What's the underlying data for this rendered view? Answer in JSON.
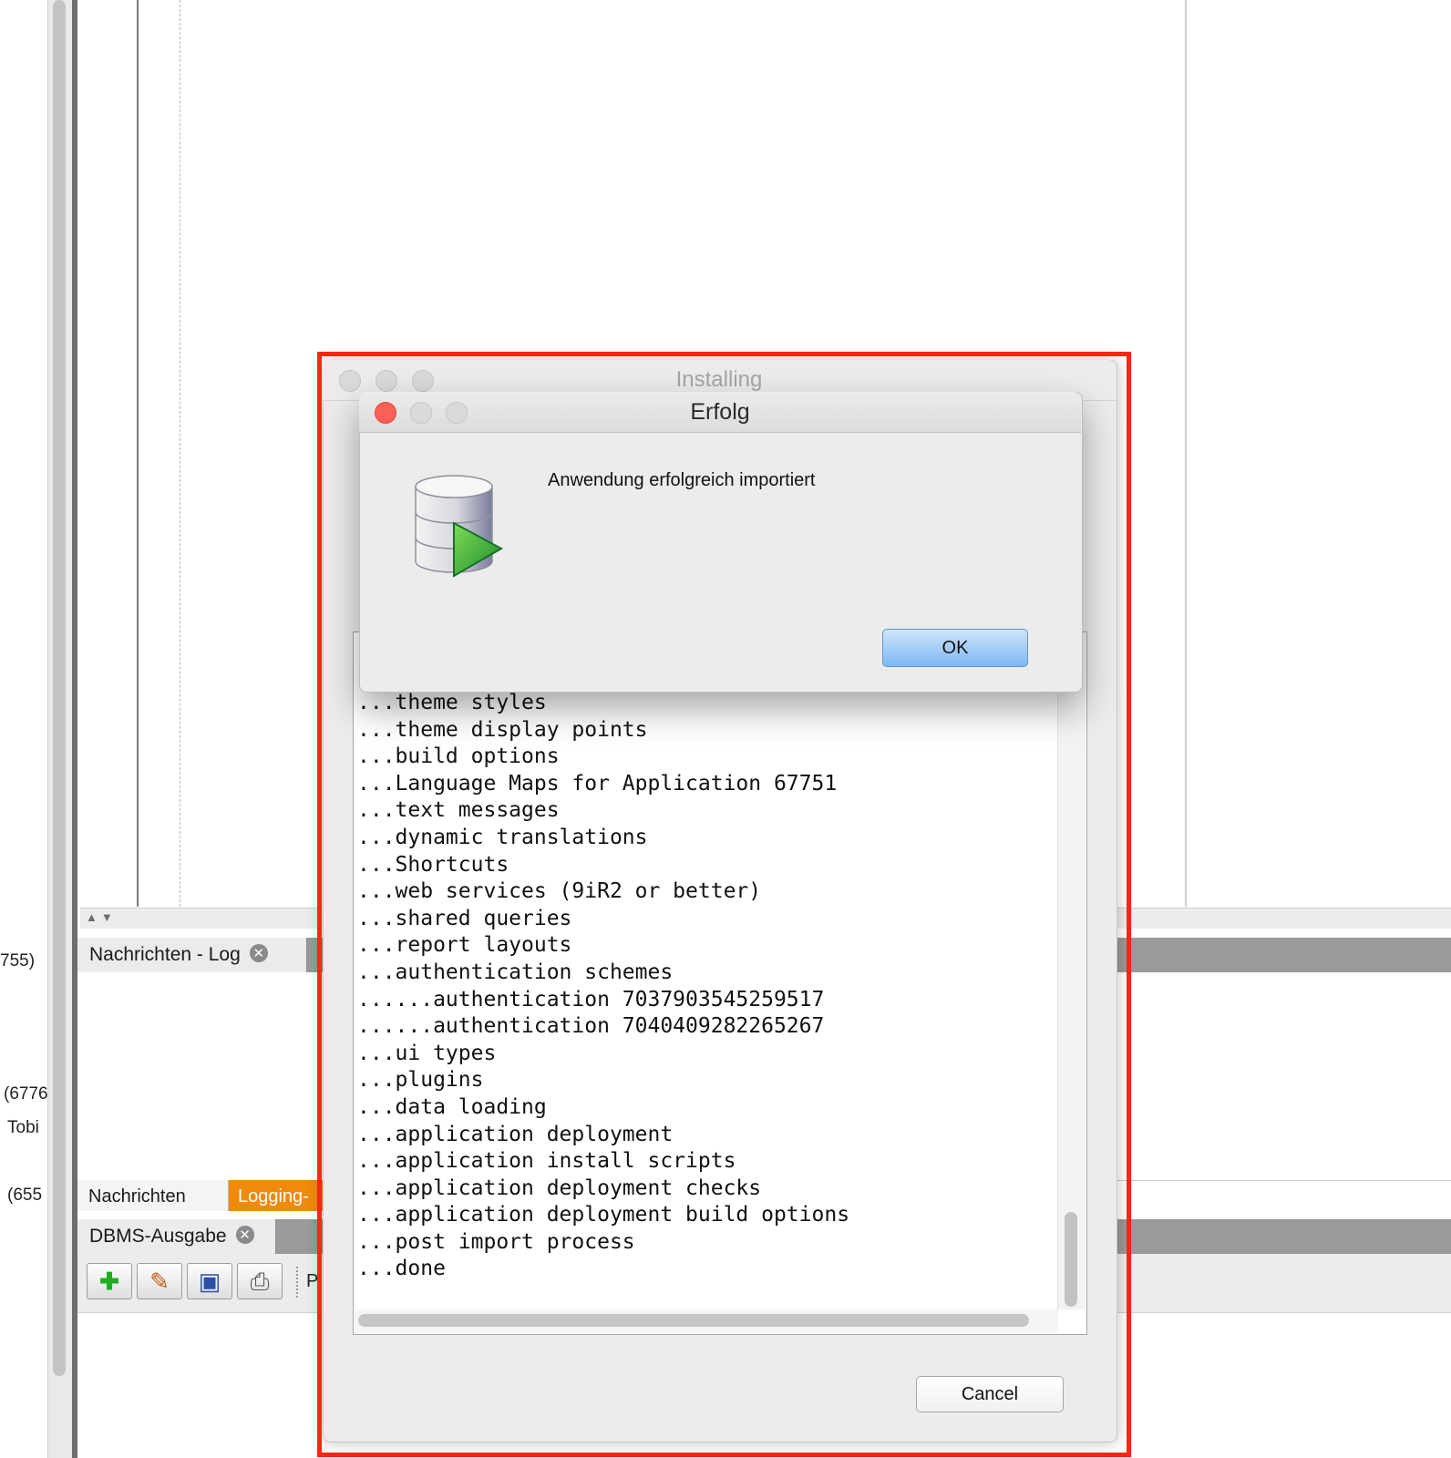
{
  "left_panel": {
    "snippets": [
      "755)",
      "(6776",
      "Tobi",
      "(655"
    ]
  },
  "bottom": {
    "log_tab_label": "Nachrichten - Log",
    "bottom_tabs": {
      "messages": "Nachrichten",
      "logging": "Logging-"
    },
    "dbms_tab_label": "DBMS-Ausgabe",
    "toolbar_trailing_text": "P",
    "colors": {
      "logging_tab": "#f08a0b"
    }
  },
  "installing_dialog": {
    "title": "Installing",
    "log_lines": [
      "...theme styles",
      "...theme display points",
      "...build options",
      "...Language Maps for Application 67751",
      "...text messages",
      "...dynamic translations",
      "...Shortcuts",
      "...web services (9iR2 or better)",
      "...shared queries",
      "...report layouts",
      "...authentication schemes",
      "......authentication 7037903545259517",
      "......authentication 7040409282265267",
      "...ui types",
      "...plugins",
      "...data loading",
      "...application deployment",
      "...application install scripts",
      "...application deployment checks",
      "...application deployment build options",
      "...post import process",
      "...done"
    ],
    "cancel_label": "Cancel"
  },
  "erfolg_dialog": {
    "title": "Erfolg",
    "message": "Anwendung erfolgreich importiert",
    "ok_label": "OK",
    "icon": "database-run-icon"
  },
  "highlight": {
    "color": "#f22a12"
  }
}
